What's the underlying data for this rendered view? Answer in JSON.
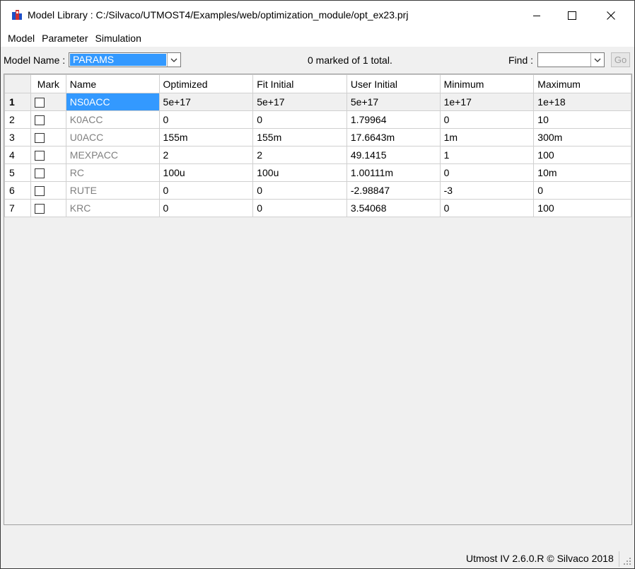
{
  "window": {
    "title": "Model Library : C:/Silvaco/UTMOST4/Examples/web/optimization_module/opt_ex23.prj"
  },
  "menu": [
    "Model",
    "Parameter",
    "Simulation"
  ],
  "toolbar": {
    "model_label": "Model Name :",
    "model_value": "PARAMS",
    "status": "0 marked of 1 total.",
    "find_label": "Find :",
    "find_value": "",
    "go_label": "Go"
  },
  "grid": {
    "columns": [
      "Mark",
      "Name",
      "Optimized",
      "Fit Initial",
      "User Initial",
      "Minimum",
      "Maximum"
    ],
    "rows": [
      {
        "num": "1",
        "name": "NS0ACC",
        "optimized": "5e+17",
        "fit_initial": "5e+17",
        "user_initial": "5e+17",
        "minimum": "1e+17",
        "maximum": "1e+18"
      },
      {
        "num": "2",
        "name": "K0ACC",
        "optimized": "0",
        "fit_initial": "0",
        "user_initial": "1.79964",
        "minimum": "0",
        "maximum": "10"
      },
      {
        "num": "3",
        "name": "U0ACC",
        "optimized": "155m",
        "fit_initial": "155m",
        "user_initial": "17.6643m",
        "minimum": "1m",
        "maximum": "300m"
      },
      {
        "num": "4",
        "name": "MEXPACC",
        "optimized": "2",
        "fit_initial": "2",
        "user_initial": "49.1415",
        "minimum": "1",
        "maximum": "100"
      },
      {
        "num": "5",
        "name": "RC",
        "optimized": "100u",
        "fit_initial": "100u",
        "user_initial": "1.00111m",
        "minimum": "0",
        "maximum": "10m"
      },
      {
        "num": "6",
        "name": "RUTE",
        "optimized": "0",
        "fit_initial": "0",
        "user_initial": "-2.98847",
        "minimum": "-3",
        "maximum": "0"
      },
      {
        "num": "7",
        "name": "KRC",
        "optimized": "0",
        "fit_initial": "0",
        "user_initial": "3.54068",
        "minimum": "0",
        "maximum": "100"
      }
    ]
  },
  "statusbar": {
    "copyright": "Utmost IV 2.6.0.R © Silvaco 2018"
  },
  "colors": {
    "selection": "#3399ff",
    "name_text": "#808080"
  }
}
